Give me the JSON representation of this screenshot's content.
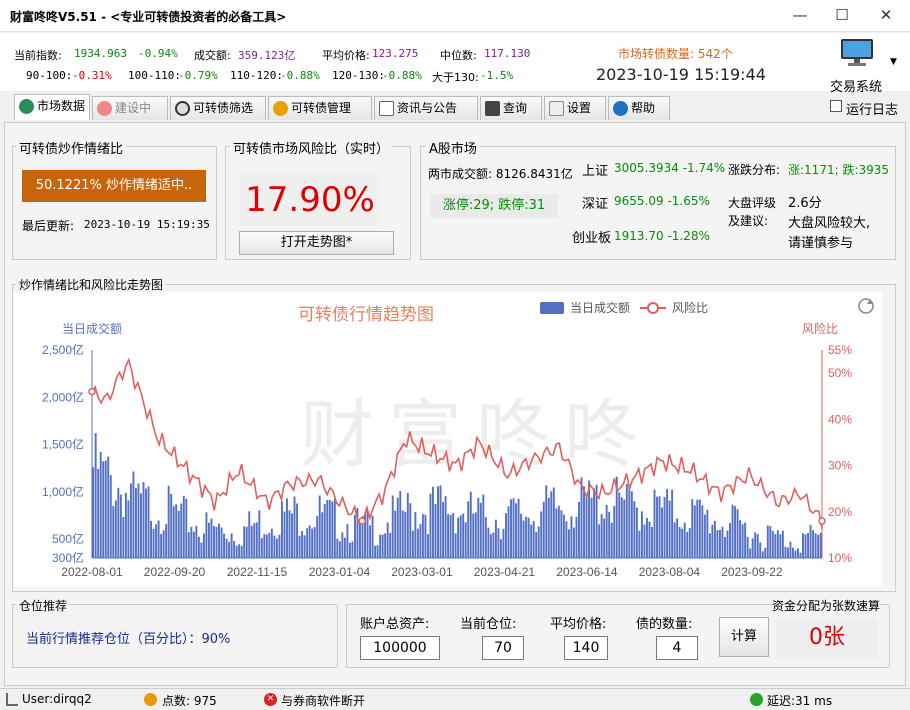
{
  "window": {
    "title": "财富咚咚V5.51 - <专业可转债投资者的必备工具>",
    "min": "—",
    "max": "☐",
    "close": "✕"
  },
  "ticker": {
    "index_label": "当前指数:",
    "index_val": "1934.963",
    "index_chg": "-0.94%",
    "turnover_label": "成交额:",
    "turnover_val": "359.123亿",
    "avg_label": "平均价格:",
    "avg_val": "123.275",
    "median_label": "中位数:",
    "median_val": "117.130",
    "r1": "90-100:",
    "r1v": "-0.31%",
    "r2": "100-110:",
    "r2v": "-0.79%",
    "r3": "110-120:",
    "r3v": "-0.88%",
    "r4": "120-130:",
    "r4v": "-0.88%",
    "r5": "大于130:",
    "r5v": "-1.5%",
    "count": "市场转债数量: 542个",
    "datetime": "2023-10-19 15:19:44",
    "trade_label": "交易系统",
    "log_label": "运行日志"
  },
  "tabs": [
    {
      "label": "市场数据"
    },
    {
      "label": "建设中"
    },
    {
      "label": "可转债筛选"
    },
    {
      "label": "可转债管理"
    },
    {
      "label": "资讯与公告"
    },
    {
      "label": "查询"
    },
    {
      "label": "设置"
    },
    {
      "label": "帮助"
    }
  ],
  "sentiment": {
    "title": "可转债炒作情绪比",
    "value": "50.1221% 炒作情绪适中..",
    "updated_label": "最后更新:",
    "updated": "2023-10-19 15:19:35"
  },
  "risk": {
    "title": "可转债市场风险比（实时）",
    "value": "17.90%",
    "button": "打开走势图*"
  },
  "ashare": {
    "title": "A股市场",
    "turnover": "两市成交额: 8126.8431亿",
    "limit": "涨停:29; 跌停:31",
    "sh_label": "上证",
    "sh": "3005.3934 -1.74%",
    "sz_label": "深证",
    "sz": "9655.09 -1.65%",
    "cy_label": "创业板",
    "cy": "1913.70 -1.28%",
    "dist_label": "涨跌分布:",
    "dist": "涨:1171; 跌:3935",
    "rating_label": "大盘评级",
    "rating_label2": "及建议:",
    "rating": "2.6分",
    "advice1": "大盘风险较大,",
    "advice2": "请谨慎参与"
  },
  "chart_section": {
    "title": "炒作情绪比和风险比走势图",
    "watermark": "财富咚咚"
  },
  "chart_data": {
    "type": "bar+line",
    "title": "可转债行情趋势图",
    "legend": [
      "当日成交额",
      "风险比"
    ],
    "legend_position": "top-right",
    "ylabel_left": "当日成交额",
    "ylabel_right": "风险比",
    "y_left_ticks": [
      "300亿",
      "500亿",
      "1,000亿",
      "1,500亿",
      "2,000亿",
      "2,500亿"
    ],
    "y_right_ticks": [
      "10%",
      "20%",
      "30%",
      "40%",
      "50%",
      "55%"
    ],
    "ylim_left": [
      300,
      2500
    ],
    "ylim_right": [
      10,
      55
    ],
    "x_ticks": [
      "2022-08-01",
      "2022-09-20",
      "2022-11-15",
      "2023-01-04",
      "2023-03-01",
      "2023-04-21",
      "2023-06-14",
      "2023-08-04",
      "2023-09-22"
    ],
    "turnover_keypoints": [
      [
        0,
        1050
      ],
      [
        0.03,
        900
      ],
      [
        0.06,
        750
      ],
      [
        0.1,
        680
      ],
      [
        0.15,
        520
      ],
      [
        0.2,
        480
      ],
      [
        0.25,
        620
      ],
      [
        0.3,
        650
      ],
      [
        0.35,
        560
      ],
      [
        0.38,
        500
      ],
      [
        0.43,
        660
      ],
      [
        0.48,
        700
      ],
      [
        0.52,
        640
      ],
      [
        0.56,
        600
      ],
      [
        0.6,
        650
      ],
      [
        0.65,
        700
      ],
      [
        0.7,
        760
      ],
      [
        0.74,
        700
      ],
      [
        0.78,
        680
      ],
      [
        0.82,
        640
      ],
      [
        0.86,
        580
      ],
      [
        0.9,
        500
      ],
      [
        0.94,
        420
      ],
      [
        1,
        420
      ]
    ],
    "risk_keypoints": [
      [
        0,
        46
      ],
      [
        0.02,
        44
      ],
      [
        0.04,
        50
      ],
      [
        0.05,
        52
      ],
      [
        0.07,
        44
      ],
      [
        0.09,
        36
      ],
      [
        0.13,
        29
      ],
      [
        0.17,
        22
      ],
      [
        0.2,
        29
      ],
      [
        0.24,
        22
      ],
      [
        0.27,
        26
      ],
      [
        0.31,
        27
      ],
      [
        0.34,
        22
      ],
      [
        0.37,
        18
      ],
      [
        0.4,
        24
      ],
      [
        0.43,
        36
      ],
      [
        0.46,
        33
      ],
      [
        0.5,
        30
      ],
      [
        0.53,
        35
      ],
      [
        0.57,
        28
      ],
      [
        0.6,
        31
      ],
      [
        0.64,
        34
      ],
      [
        0.67,
        25
      ],
      [
        0.7,
        24
      ],
      [
        0.74,
        27
      ],
      [
        0.78,
        31
      ],
      [
        0.82,
        29
      ],
      [
        0.86,
        24
      ],
      [
        0.9,
        28
      ],
      [
        0.94,
        22
      ],
      [
        0.97,
        24
      ],
      [
        1,
        18
      ]
    ],
    "colors": {
      "bar": "#5470c6",
      "line": "#e06060"
    }
  },
  "position": {
    "title": "仓位推荐",
    "text": "当前行情推荐仓位（百分比）：90%",
    "assets_label": "账户总资产:",
    "assets": "100000",
    "pos_label": "当前仓位:",
    "pos": "70",
    "price_label": "平均价格:",
    "price": "140",
    "qty_label": "债的数量:",
    "qty": "4",
    "calc": "计算",
    "alloc_label": "资金分配为张数速算",
    "alloc": "0张"
  },
  "status": {
    "user": "User:dirqq2",
    "points": "点数: 975",
    "broker": "与券商软件断开",
    "latency": "延迟:31 ms"
  }
}
